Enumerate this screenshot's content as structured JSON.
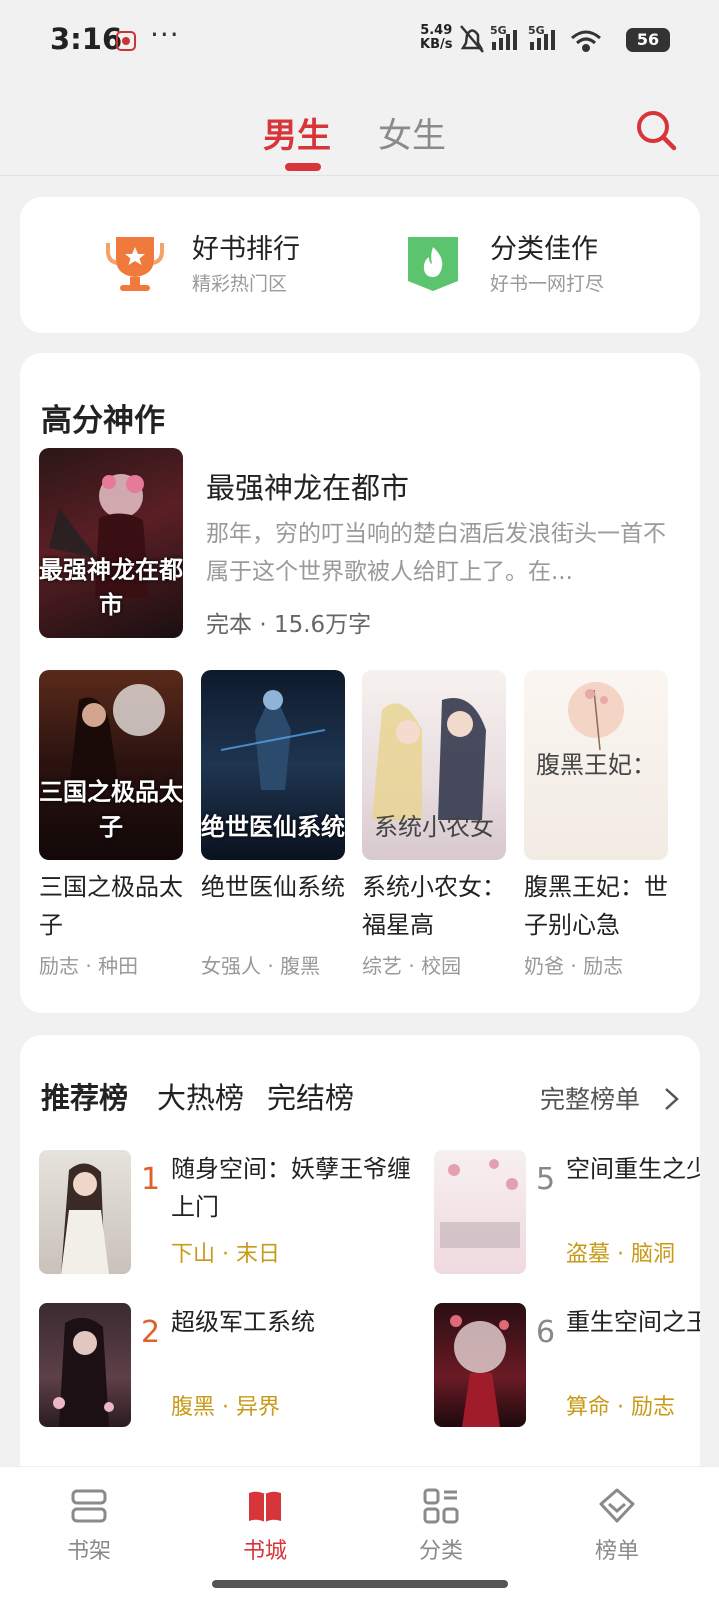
{
  "status": {
    "time": "3:16",
    "more": "···",
    "speed_value": "5.49",
    "speed_unit": "KB/s",
    "network": "5G",
    "battery": "56"
  },
  "header": {
    "tabs": [
      {
        "label": "男生",
        "active": true
      },
      {
        "label": "女生",
        "active": false
      }
    ],
    "search_icon": "search-icon"
  },
  "quick": [
    {
      "title": "好书排行",
      "subtitle": "精彩热门区",
      "icon": "trophy-icon"
    },
    {
      "title": "分类佳作",
      "subtitle": "好书一网打尽",
      "icon": "flame-icon"
    }
  ],
  "featured": {
    "section_title": "高分神作",
    "main": {
      "title": "最强神龙在都市",
      "description": "那年，穷的叮当响的楚白酒后发浪街头一首不属于这个世界歌被人给盯上了。在...",
      "status": "完本",
      "words": "15.6万字",
      "cover_text": "最强神龙在都市"
    },
    "grid": [
      {
        "title": "三国之极品太子",
        "tags": "励志 · 种田",
        "cover_text": "三国之极品太子"
      },
      {
        "title": "绝世医仙系统",
        "tags": "女强人 · 腹黑",
        "cover_text": "绝世医仙系统"
      },
      {
        "title": "系统小农女：福星高",
        "tags": "综艺 · 校园",
        "cover_text": "系统小农女"
      },
      {
        "title": "腹黑王妃：世子别心急",
        "tags": "奶爸 · 励志",
        "cover_text": "腹黑王妃："
      }
    ]
  },
  "ranking": {
    "tabs": [
      {
        "label": "推荐榜",
        "active": true
      },
      {
        "label": "大热榜",
        "active": false
      },
      {
        "label": "完结榜",
        "active": false
      }
    ],
    "full_list": "完整榜单",
    "items": [
      {
        "rank": "1",
        "title": "随身空间：妖孽王爷缠上门",
        "tags": "下山 · 末日"
      },
      {
        "rank": "2",
        "title": "超级军工系统",
        "tags": "腹黑 · 异界"
      },
      {
        "rank": "5",
        "title": "空间重生之少宠翻天",
        "tags": "盗墓 · 脑洞"
      },
      {
        "rank": "6",
        "title": "重生空间之王心尖宠",
        "tags": "算命 · 励志"
      }
    ]
  },
  "bottom_nav": [
    {
      "label": "书架",
      "icon": "bookshelf-icon",
      "active": false
    },
    {
      "label": "书城",
      "icon": "bookstore-icon",
      "active": true
    },
    {
      "label": "分类",
      "icon": "category-icon",
      "active": false
    },
    {
      "label": "榜单",
      "icon": "ranking-icon",
      "active": false
    }
  ],
  "colors": {
    "accent": "#d8353a",
    "rank_top": "#e0602a",
    "tag_gold": "#c89a18"
  }
}
